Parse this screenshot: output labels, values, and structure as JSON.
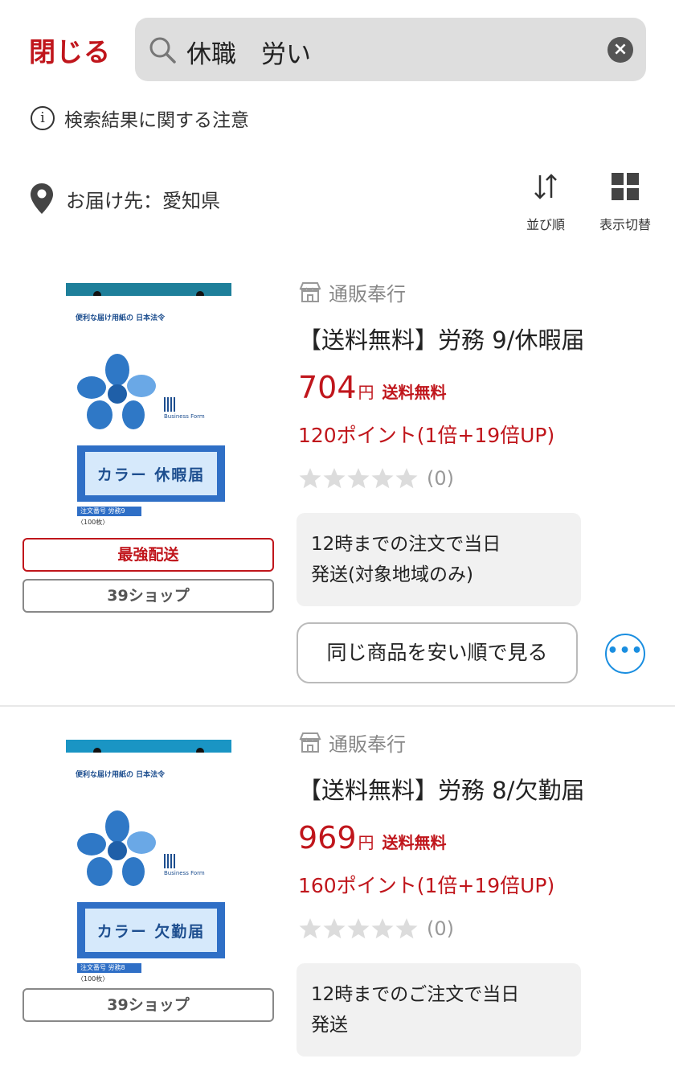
{
  "header": {
    "close_label": "閉じる",
    "search_value": "休職　労い",
    "search_icon": "search-icon",
    "clear_icon": "clear-icon"
  },
  "notice": {
    "text": "検索結果に関する注意",
    "icon": "info-icon"
  },
  "delivery": {
    "text": "お届け先：愛知県",
    "icon": "location-pin-icon"
  },
  "toolbar": {
    "sort_label": "並び順",
    "view_label": "表示切替"
  },
  "colors": {
    "accent_red": "#c0161c",
    "link_blue": "#1a8ee0",
    "muted_gray": "#888888"
  },
  "products": [
    {
      "thumb_brand": "便利な届け用紙の 日本法令",
      "thumb_label": "カラー 休暇届",
      "thumb_order": "注文番号 労務9",
      "thumb_qty": "〈100枚〉",
      "thumb_biz": "Business Form",
      "badges": [
        "最強配送",
        "39ショップ"
      ],
      "shop": "通販奉行",
      "title": "【送料無料】労務 9/休暇届",
      "price": "704",
      "yen": "円",
      "shipping": "送料無料",
      "points": "120ポイント(1倍+19倍UP)",
      "review_count": "(0)",
      "rating": 0,
      "ship_note_line1": "12時までの注文で当日",
      "ship_note_line2": "発送(対象地域のみ)",
      "cheap_button": "同じ商品を安い順で見る",
      "more_button": "•••"
    },
    {
      "thumb_brand": "便利な届け用紙の 日本法令",
      "thumb_label": "カラー 欠勤届",
      "thumb_order": "注文番号 労務8",
      "thumb_qty": "〈100枚〉",
      "thumb_biz": "Business Form",
      "badges": [
        "39ショップ"
      ],
      "shop": "通販奉行",
      "title": "【送料無料】労務 8/欠勤届",
      "price": "969",
      "yen": "円",
      "shipping": "送料無料",
      "points": "160ポイント(1倍+19倍UP)",
      "review_count": "(0)",
      "rating": 0,
      "ship_note_line1": "12時までのご注文で当日",
      "ship_note_line2": "発送"
    }
  ]
}
